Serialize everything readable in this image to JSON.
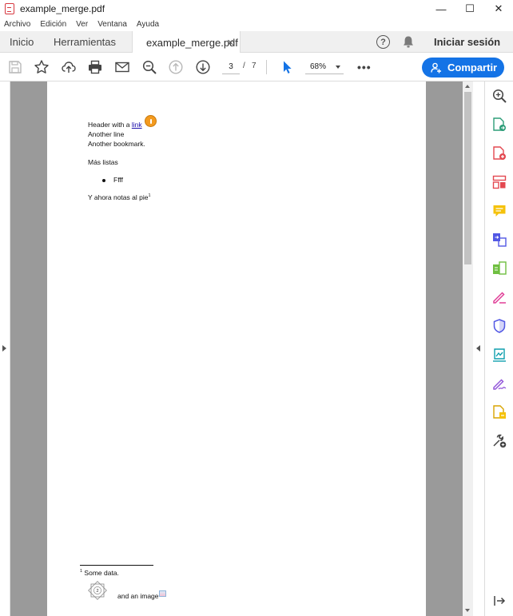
{
  "window": {
    "title": "example_merge.pdf",
    "minimize": "—",
    "maximize": "☐",
    "close": "✕"
  },
  "menu": [
    "Archivo",
    "Edición",
    "Ver",
    "Ventana",
    "Ayuda"
  ],
  "tabs": {
    "home": "Inicio",
    "tools": "Herramientas",
    "document": "example_merge.pdf",
    "close": "✕"
  },
  "header": {
    "help": "?",
    "signin": "Iniciar sesión"
  },
  "toolbar": {
    "current_page": "3",
    "page_separator": "/",
    "total_pages": "7",
    "zoom": "68%",
    "more": "•••",
    "share_label": "Compartir"
  },
  "document": {
    "header_text": "Header with a ",
    "link_text": "link",
    "line2": "Another line",
    "line3": "Another bookmark.",
    "heading": "Más listas",
    "bullet": "Ffff",
    "footnote_line": "Y ahora notas al pie",
    "footnote_mark": "1",
    "footnote_num": "1",
    "footnote_text": " Some data.",
    "diagram_label": "2",
    "image_caption": "and an image"
  },
  "colors": {
    "accent": "#1473e6",
    "viewport_bg": "#9a9a9a",
    "note": "#f39a1e"
  },
  "right_tools": [
    "zoom-search-icon",
    "export-pdf-icon",
    "create-pdf-icon",
    "organize-pages-icon",
    "comment-icon",
    "combine-files-icon",
    "edit-pdf-icon",
    "fill-sign-icon",
    "protect-icon",
    "scan-enhance-icon",
    "request-signature-icon",
    "compress-pdf-icon",
    "more-tools-icon",
    "collapse-panel-icon"
  ]
}
